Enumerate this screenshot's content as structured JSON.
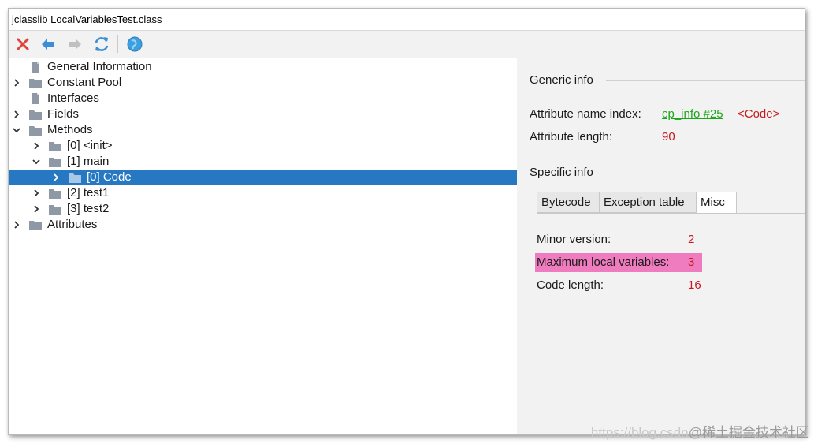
{
  "window": {
    "title": "jclasslib LocalVariablesTest.class"
  },
  "toolbar": {
    "buttons": [
      {
        "name": "close",
        "icon": "close-icon",
        "color": "#e0443b"
      },
      {
        "name": "back",
        "icon": "arrow-left-icon",
        "color": "#3c8fd6"
      },
      {
        "name": "forward",
        "icon": "arrow-right-icon",
        "color": "#c0c0c0"
      },
      {
        "name": "reload",
        "icon": "reload-icon",
        "color": "#3c8fd6"
      },
      {
        "name": "web",
        "icon": "globe-icon",
        "color": "#3c9fe0"
      }
    ]
  },
  "tree": {
    "items": [
      {
        "label": "General Information",
        "icon": "file-icon",
        "expander": "none"
      },
      {
        "label": "Constant Pool",
        "icon": "folder-icon",
        "expander": "collapsed"
      },
      {
        "label": "Interfaces",
        "icon": "file-icon",
        "expander": "none"
      },
      {
        "label": "Fields",
        "icon": "folder-icon",
        "expander": "collapsed"
      },
      {
        "label": "Methods",
        "icon": "folder-icon",
        "expander": "expanded"
      },
      {
        "label": "[0] <init>",
        "icon": "folder-icon",
        "expander": "collapsed"
      },
      {
        "label": "[1] main",
        "icon": "folder-icon",
        "expander": "expanded"
      },
      {
        "label": "[0] Code",
        "icon": "folder-icon",
        "expander": "collapsed",
        "selected": true
      },
      {
        "label": "[2] test1",
        "icon": "folder-icon",
        "expander": "collapsed"
      },
      {
        "label": "[3] test2",
        "icon": "folder-icon",
        "expander": "collapsed"
      },
      {
        "label": "Attributes",
        "icon": "folder-icon",
        "expander": "collapsed"
      }
    ]
  },
  "generic_info": {
    "title": "Generic info",
    "attr_name_label": "Attribute name index:",
    "attr_name_link": "cp_info #25",
    "attr_name_value": "<Code>",
    "attr_length_label": "Attribute length:",
    "attr_length_value": "90"
  },
  "specific_info": {
    "title": "Specific info",
    "tabs": [
      {
        "label": "Bytecode",
        "active": false
      },
      {
        "label": "Exception table",
        "active": false
      },
      {
        "label": "Misc",
        "active": true
      }
    ],
    "misc": {
      "minor_version_label": "Minor version:",
      "minor_version_value": "2",
      "max_locals_label": "Maximum local variables:",
      "max_locals_value": "3",
      "code_length_label": "Code length:",
      "code_length_value": "16"
    }
  },
  "watermark": {
    "url": "https://blog.csdn",
    "text": "@稀土掘金技术社区"
  },
  "colors": {
    "selection": "#2678c2",
    "value_red": "#c8181b",
    "link_green": "#1ca61c",
    "highlight_pink": "#f07cc0"
  }
}
